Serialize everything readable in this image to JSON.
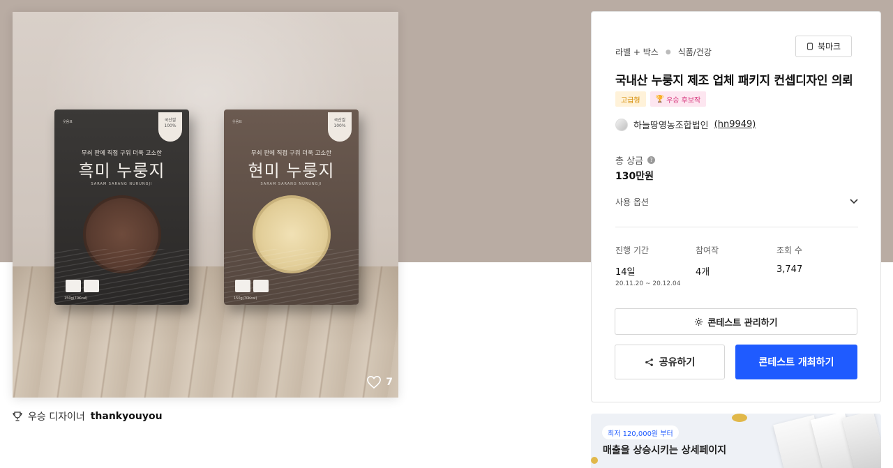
{
  "product": {
    "like_count": "7",
    "designer_prefix": "우승 디자이너",
    "designer_name": "thankyouyou",
    "packages": [
      {
        "brand": "웃음표",
        "badge": "국산쌀 100%",
        "tagline": "무쇠 판에 직접 구워 더욱 고소한",
        "name": "흑미 누룽지",
        "sub": "SARAM SARANG NURUNGJI",
        "cert1": "HACCP",
        "cert2": "",
        "weight": "150g(70Kcal)"
      },
      {
        "brand": "웃음표",
        "badge": "국산쌀 100%",
        "tagline": "무쇠 판에 직접 구워 더욱 고소한",
        "name": "현미 누룽지",
        "sub": "SARAM SARANG NURUNGJI",
        "cert1": "HACCP",
        "cert2": "",
        "weight": "150g(70Kcal)"
      }
    ]
  },
  "card": {
    "breadcrumb": [
      "라벨 + 박스",
      "식품/건강"
    ],
    "bookmark_label": "북마크",
    "title": "국내산 누룽지 제조 업체 패키지 컨셉디자인 의뢰",
    "tags": {
      "premium": "고급형",
      "winner": "우승 후보작"
    },
    "host": {
      "name": "하늘땅영농조합법인",
      "id": "(hn9949)"
    },
    "prize_label": "총 상금",
    "prize_value": "130만원",
    "usage_label": "사용 옵션",
    "stats": {
      "period_label": "진행 기간",
      "period_value": "14일",
      "period_dates": "20.11.20 ~ 20.12.04",
      "participants_label": "참여작",
      "participants_value": "4개",
      "views_label": "조회 수",
      "views_value": "3,747"
    },
    "manage_label": "콘테스트 관리하기",
    "share_label": "공유하기",
    "host_contest_label": "콘테스트 개최하기"
  },
  "banner": {
    "pill": "최저 120,000원 부터",
    "headline": "매출을 상승시키는 상세페이지"
  },
  "colors": {
    "primary": "#1f5bff",
    "hero_bg": "#b9aca3",
    "premium_tag": "#d48b00",
    "winner_tag": "#d6357b"
  }
}
